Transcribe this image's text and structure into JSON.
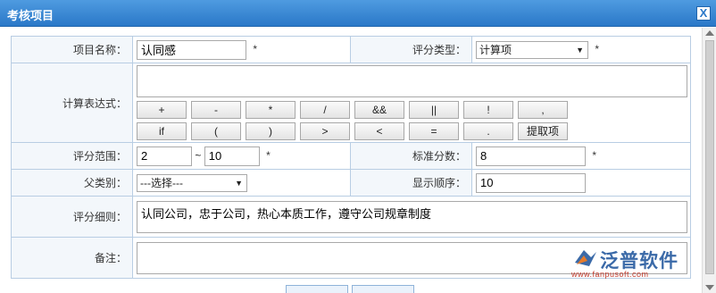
{
  "dialog": {
    "title": "考核项目",
    "close_label": "X"
  },
  "form": {
    "name": {
      "label": "项目名称：",
      "value": "认同感",
      "required": "*"
    },
    "type": {
      "label": "评分类型：",
      "value": "计算项",
      "required": "*"
    },
    "expression": {
      "label": "计算表达式：",
      "value": ""
    },
    "operators_row1": [
      "+",
      "-",
      "*",
      "/",
      "&&",
      "||",
      "!",
      ","
    ],
    "operators_row2": [
      "if",
      "(",
      ")",
      ">",
      "<",
      "=",
      ".",
      "提取项"
    ],
    "range": {
      "label": "评分范围：",
      "min": "2",
      "sep": "~",
      "max": "10",
      "required": "*"
    },
    "standard": {
      "label": "标准分数：",
      "value": "8",
      "required": "*"
    },
    "parent": {
      "label": "父类别：",
      "value": "---选择---"
    },
    "order": {
      "label": "显示顺序：",
      "value": "10"
    },
    "detail": {
      "label": "评分细则：",
      "value": "认同公司，忠于公司，热心本质工作，遵守公司规章制度"
    },
    "remark": {
      "label": "备注：",
      "value": ""
    }
  },
  "watermark": {
    "brand": "泛普软件",
    "url": "www.fanpusoft.com"
  }
}
